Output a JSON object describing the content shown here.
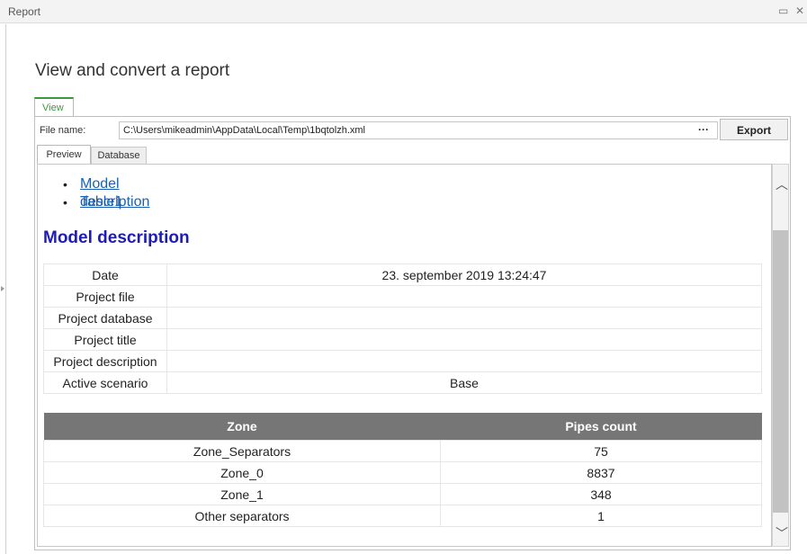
{
  "window": {
    "title": "Report"
  },
  "page_title": "View and convert a report",
  "outer_tab": "View",
  "file": {
    "label": "File name:",
    "path": "C:\\Users\\mikeadmin\\AppData\\Local\\Temp\\1bqtolzh.xml",
    "browse": "···",
    "export": "Export"
  },
  "inner_tabs": [
    "Preview",
    "Database"
  ],
  "toc": [
    "Model description",
    "Table1"
  ],
  "section_heading": "Model description",
  "description": [
    {
      "key": "Date",
      "value": "23. september 2019 13:24:47"
    },
    {
      "key": "Project file",
      "value": ""
    },
    {
      "key": "Project database",
      "value": ""
    },
    {
      "key": "Project title",
      "value": ""
    },
    {
      "key": "Project description",
      "value": ""
    },
    {
      "key": "Active scenario",
      "value": "Base"
    }
  ],
  "zones": {
    "headers": [
      "Zone",
      "Pipes count"
    ],
    "rows": [
      [
        "Zone_Separators",
        "75"
      ],
      [
        "Zone_0",
        "8837"
      ],
      [
        "Zone_1",
        "348"
      ],
      [
        "Other separators",
        "1"
      ]
    ]
  }
}
